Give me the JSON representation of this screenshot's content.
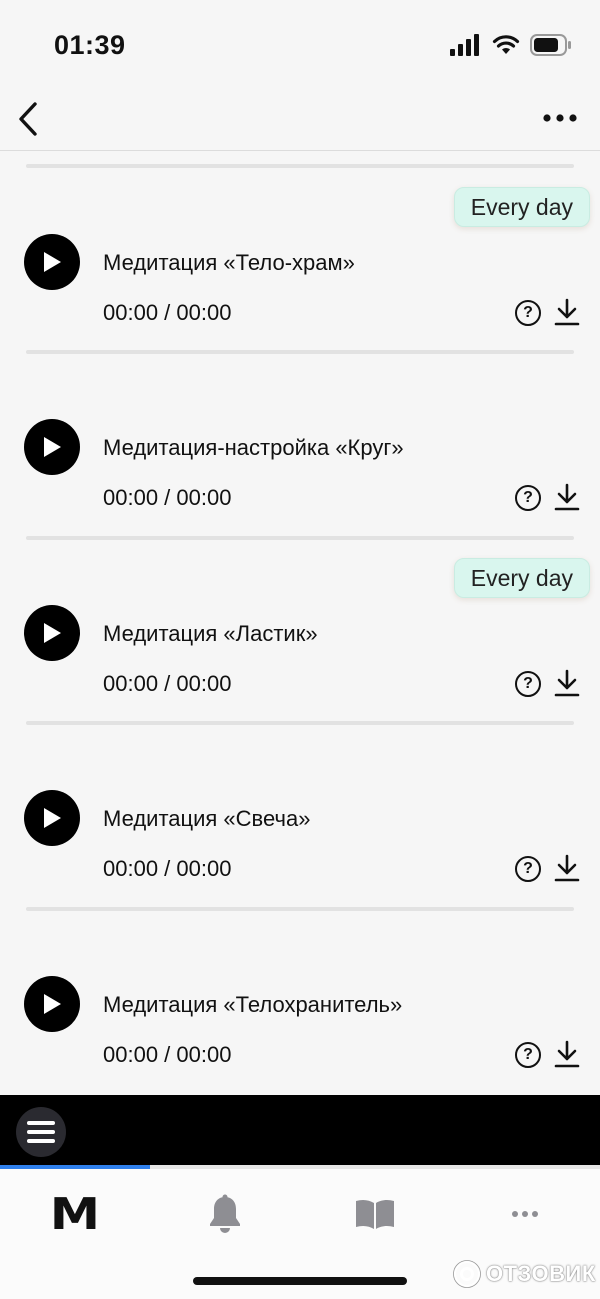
{
  "status_bar": {
    "time": "01:39"
  },
  "badge_label": "Every day",
  "tracks": [
    {
      "title": "Медитация «Тело-храм»",
      "time": "00:00 / 00:00",
      "every_day": true
    },
    {
      "title": "Медитация-настройка «Круг»",
      "time": "00:00 / 00:00",
      "every_day": false
    },
    {
      "title": "Медитация «Ластик»",
      "time": "00:00 / 00:00",
      "every_day": true
    },
    {
      "title": "Медитация «Свеча»",
      "time": "00:00 / 00:00",
      "every_day": false
    },
    {
      "title": "Медитация «Телохранитель»",
      "time": "00:00 / 00:00",
      "every_day": false
    }
  ],
  "help_glyph": "?",
  "player": {
    "progress": 0.25
  },
  "tab_bar": {
    "tabs": [
      {
        "icon": "m-logo-icon",
        "label": "M",
        "active": true
      },
      {
        "icon": "bell-icon",
        "active": false
      },
      {
        "icon": "book-icon",
        "active": false
      },
      {
        "icon": "more-icon",
        "active": false
      }
    ]
  },
  "watermark": "ОТЗОВИК",
  "colors": {
    "badge_bg": "#d9f6ee",
    "accent": "#2f80ed",
    "player_bg": "#000000"
  }
}
